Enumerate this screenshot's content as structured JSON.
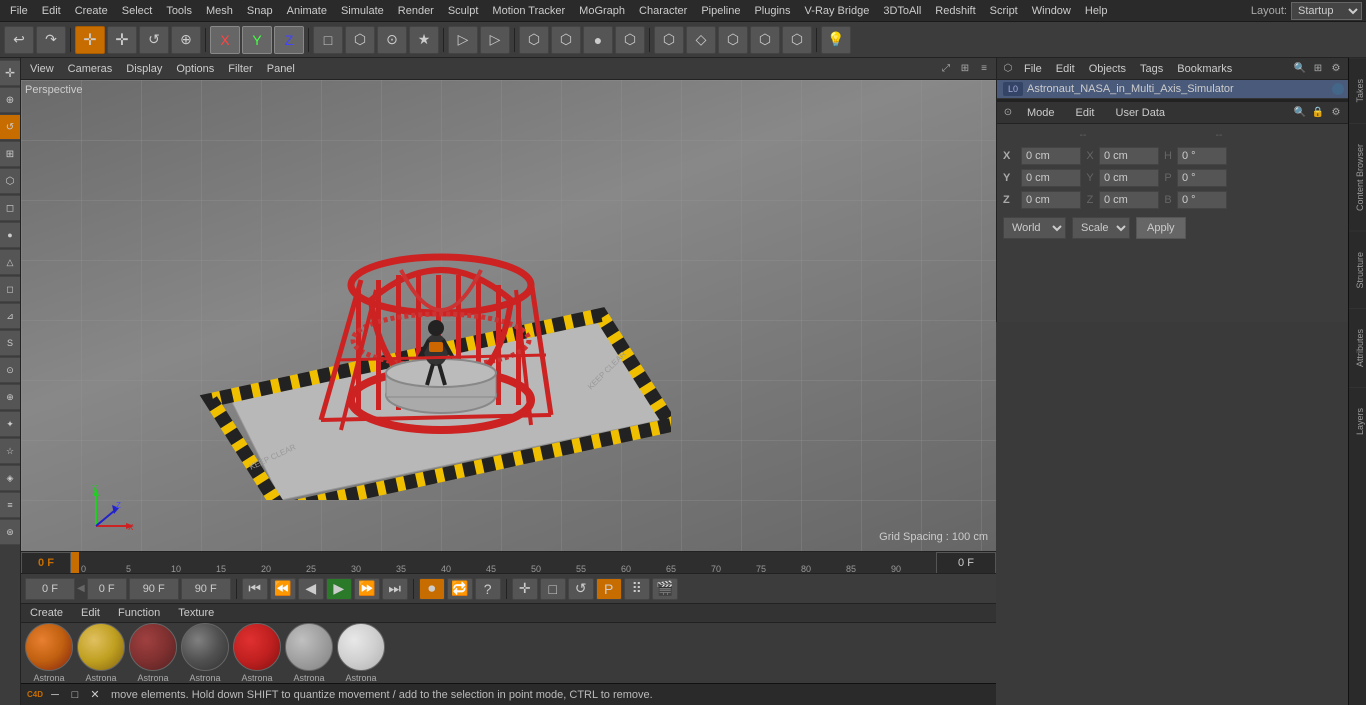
{
  "menubar": {
    "items": [
      "File",
      "Edit",
      "Create",
      "Select",
      "Tools",
      "Mesh",
      "Snap",
      "Animate",
      "Simulate",
      "Render",
      "Sculpt",
      "Motion Tracker",
      "MoGraph",
      "Character",
      "Pipeline",
      "Plugins",
      "V-Ray Bridge",
      "3DToAll",
      "Redshift",
      "Script",
      "Window",
      "Help"
    ],
    "layout_label": "Layout:",
    "layout_value": "Startup"
  },
  "toolbar": {
    "undo_label": "↩",
    "redo_label": "↷",
    "buttons": [
      "↩",
      "↷",
      "✦",
      "✛",
      "↺",
      "⊕",
      "X",
      "Y",
      "Z",
      "□",
      "⬡",
      "⊙",
      "★",
      "▷",
      "▷",
      "▷",
      "▷",
      "⬡",
      "⬡",
      "●",
      "⬡",
      "⬡",
      "⬡",
      "◇",
      "⬡",
      "⬡",
      "⬡",
      "⬡",
      "⬡",
      "💡"
    ]
  },
  "viewport": {
    "label": "Perspective",
    "menus": [
      "View",
      "Cameras",
      "Display",
      "Options",
      "Filter",
      "Panel"
    ],
    "grid_spacing": "Grid Spacing : 100 cm"
  },
  "timeline": {
    "marks": [
      "0",
      "5",
      "10",
      "15",
      "20",
      "25",
      "30",
      "35",
      "40",
      "45",
      "50",
      "55",
      "60",
      "65",
      "70",
      "75",
      "80",
      "85",
      "90"
    ],
    "current_frame": "0 F",
    "frame_start": "0 F",
    "frame_end": "90 F",
    "frame_end2": "90 F",
    "playback_frame": "0 F"
  },
  "objects_panel": {
    "header_menus": [
      "File",
      "Edit",
      "Objects",
      "Tags",
      "Bookmarks"
    ],
    "items": [
      {
        "label": "Astronaut_NASA_in_Multi_Axis_Simulator",
        "icon": "L0",
        "color": "#4488cc"
      }
    ]
  },
  "attr_panel": {
    "tabs": [
      "Mode",
      "Edit",
      "User Data"
    ],
    "coord_labels": [
      "X",
      "Y",
      "Z"
    ],
    "coord_sections": [
      "--",
      "--"
    ],
    "x_pos": "0 cm",
    "y_pos": "0 cm",
    "z_pos": "0 cm",
    "x_pos2": "0 cm",
    "y_pos2": "0 cm",
    "z_pos2": "0 cm",
    "h_val": "0 °",
    "p_val": "0 °",
    "b_val": "0 °",
    "world_label": "World",
    "scale_label": "Scale",
    "apply_label": "Apply"
  },
  "materials": {
    "header_menus": [
      "Create",
      "Edit",
      "Function",
      "Texture"
    ],
    "items": [
      {
        "label": "Astrona"
      },
      {
        "label": "Astrona"
      },
      {
        "label": "Astrona"
      },
      {
        "label": "Astrona"
      },
      {
        "label": "Astrona"
      },
      {
        "label": "Astrona"
      },
      {
        "label": "Astrona"
      }
    ],
    "colors": [
      "#c86020",
      "#c8c820",
      "#8c4040",
      "#606060",
      "#c03030",
      "#a0a0a0",
      "#d0d0d0"
    ]
  },
  "status_bar": {
    "text": "move elements. Hold down SHIFT to quantize movement / add to the selection in point mode, CTRL to remove."
  },
  "right_side_tabs": [
    "Takes",
    "Content Browser",
    "Structure",
    "Attributes",
    "Layers"
  ],
  "transport": {
    "frame_current": "0 F",
    "frame_marker": "0 F",
    "frame_max": "90 F",
    "frame_max2": "90 F"
  }
}
